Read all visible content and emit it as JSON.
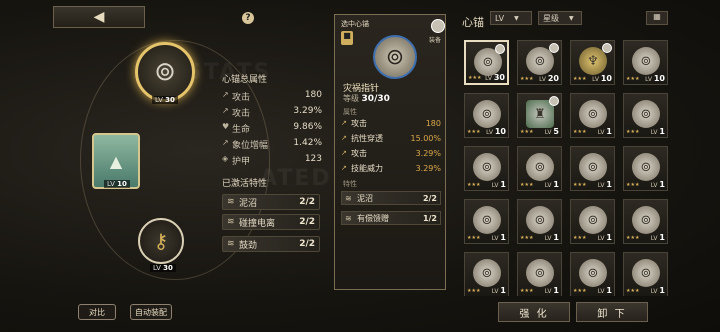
{
  "header": {
    "back_icon": "◀",
    "help_icon": "?"
  },
  "equipped": {
    "main_level_prefix": "LV",
    "main_level": "30",
    "card_level_prefix": "LV",
    "card_level": "10",
    "key_level_prefix": "LV",
    "key_level": "30"
  },
  "stats_panel": {
    "title": "心锚总属性",
    "rows": [
      {
        "icon": "↗",
        "label": "攻击",
        "value": "180"
      },
      {
        "icon": "↗",
        "label": "攻击",
        "value": "3.29%"
      },
      {
        "icon": "♥",
        "label": "生命",
        "value": "9.86%"
      },
      {
        "icon": "↗",
        "label": "象位增幅",
        "value": "1.42%"
      },
      {
        "icon": "◈",
        "label": "护甲",
        "value": "123"
      }
    ],
    "traits_title": "已激活特性",
    "traits": [
      {
        "icon": "≋",
        "label": "泥沼",
        "value": "2/2"
      },
      {
        "icon": "≋",
        "label": "碰撞电离",
        "value": "2/2"
      },
      {
        "icon": "≋",
        "label": "鼓劲",
        "value": "2/2"
      }
    ]
  },
  "detail": {
    "title": "选中心锚",
    "lock_icon": "🔒",
    "equipped_label": "装备",
    "name": "灾祸指针",
    "level_label": "等级",
    "level": "30/30",
    "attr_section": "属性",
    "attrs": [
      {
        "label": "攻击",
        "value": "180"
      },
      {
        "label": "抗性穿透",
        "value": "15.00%"
      },
      {
        "label": "攻击",
        "value": "3.29%"
      },
      {
        "label": "技能威力",
        "value": "3.29%"
      }
    ],
    "trait_section": "特性",
    "traits": [
      {
        "label": "泥沼",
        "value": "2/2"
      },
      {
        "label": "有偿馈赠",
        "value": "1/2"
      }
    ]
  },
  "inventory": {
    "title": "心锚",
    "filter_lv": "LV",
    "filter_star": "星级",
    "dropdown_icon": "▼",
    "grid_icon": "▦",
    "cells": [
      {
        "lv": "30",
        "type": "compass",
        "avatar": true,
        "selected": true
      },
      {
        "lv": "20",
        "type": "compass",
        "avatar": true,
        "selected": false
      },
      {
        "lv": "10",
        "type": "wing",
        "avatar": true,
        "selected": false
      },
      {
        "lv": "10",
        "type": "compass",
        "avatar": false,
        "selected": false
      },
      {
        "lv": "10",
        "type": "compass",
        "avatar": false,
        "selected": false
      },
      {
        "lv": "5",
        "type": "bust",
        "avatar": true,
        "selected": false
      },
      {
        "lv": "1",
        "type": "compass",
        "avatar": false,
        "selected": false
      },
      {
        "lv": "1",
        "type": "compass",
        "avatar": false,
        "selected": false
      },
      {
        "lv": "1",
        "type": "compass",
        "avatar": false,
        "selected": false
      },
      {
        "lv": "1",
        "type": "compass",
        "avatar": false,
        "selected": false
      },
      {
        "lv": "1",
        "type": "compass",
        "avatar": false,
        "selected": false
      },
      {
        "lv": "1",
        "type": "compass",
        "avatar": false,
        "selected": false
      },
      {
        "lv": "1",
        "type": "compass",
        "avatar": false,
        "selected": false
      },
      {
        "lv": "1",
        "type": "compass",
        "avatar": false,
        "selected": false
      },
      {
        "lv": "1",
        "type": "compass",
        "avatar": false,
        "selected": false
      },
      {
        "lv": "1",
        "type": "compass",
        "avatar": false,
        "selected": false
      },
      {
        "lv": "1",
        "type": "compass",
        "avatar": false,
        "selected": false
      },
      {
        "lv": "1",
        "type": "compass",
        "avatar": false,
        "selected": false
      },
      {
        "lv": "1",
        "type": "compass",
        "avatar": false,
        "selected": false
      },
      {
        "lv": "1",
        "type": "compass",
        "avatar": false,
        "selected": false
      }
    ]
  },
  "footer": {
    "compare": "对比",
    "auto_equip": "自动装配",
    "enhance": "强 化",
    "unequip": "卸 下"
  },
  "colors": {
    "accent_gold": "#e6c46c",
    "value_orange": "#d9a74a"
  }
}
